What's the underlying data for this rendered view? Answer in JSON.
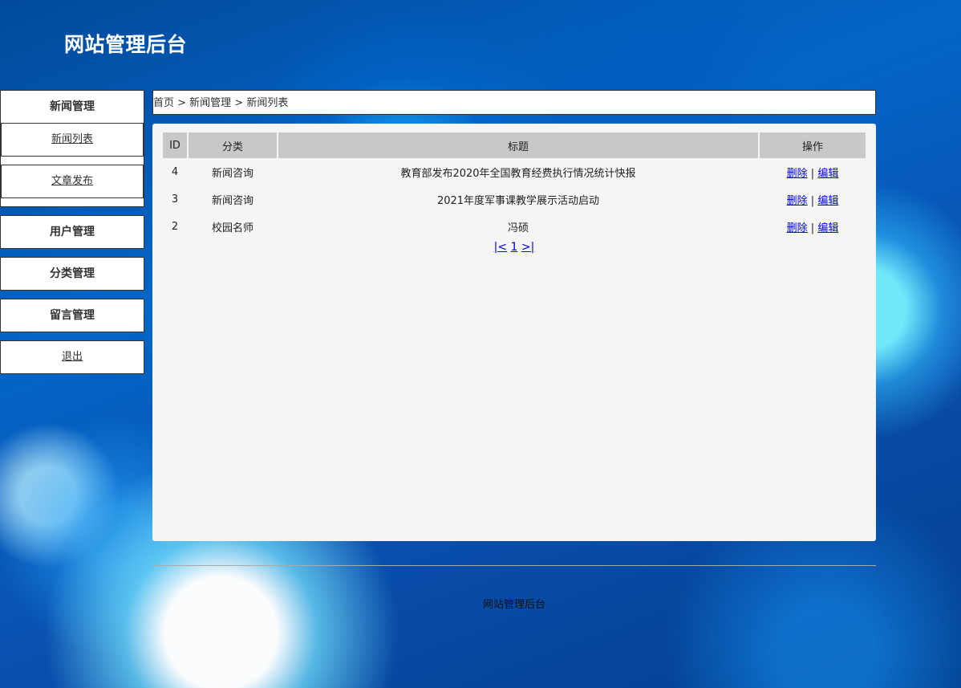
{
  "header": {
    "title": "网站管理后台"
  },
  "sidebar": {
    "news": {
      "heading": "新闻管理",
      "items": [
        {
          "label": "新闻列表"
        },
        {
          "label": "文章发布"
        }
      ]
    },
    "users": {
      "heading": "用户管理"
    },
    "categories": {
      "heading": "分类管理"
    },
    "messages": {
      "heading": "留言管理"
    },
    "logout": {
      "label": "退出"
    }
  },
  "breadcrumb": {
    "text": "首页 > 新闻管理 > 新闻列表"
  },
  "table": {
    "headers": [
      "ID",
      "分类",
      "标题",
      "操作"
    ],
    "rows": [
      {
        "id": "4",
        "category": "新闻咨询",
        "title": "教育部发布2020年全国教育经费执行情况统计快报",
        "delete": "删除",
        "edit": "编辑"
      },
      {
        "id": "3",
        "category": "新闻咨询",
        "title": "2021年度军事课教学展示活动启动",
        "delete": "删除",
        "edit": "编辑"
      },
      {
        "id": "2",
        "category": "校园名师",
        "title": "冯硕",
        "delete": "删除",
        "edit": "编辑"
      }
    ],
    "separator": " | "
  },
  "pager": {
    "first": "|<",
    "page": "1",
    "last": ">|"
  },
  "footer": {
    "text": "网站管理后台"
  }
}
